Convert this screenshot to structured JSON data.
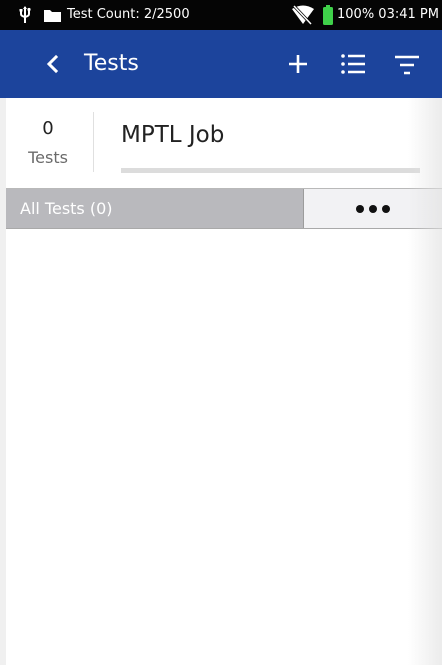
{
  "status_bar": {
    "test_count": "Test Count: 2/2500",
    "battery_time": "100% 03:41 PM"
  },
  "app_bar": {
    "title": "Tests"
  },
  "job": {
    "test_count": "0",
    "test_count_label": "Tests",
    "name": "MPTL Job"
  },
  "tests_section": {
    "label": "All Tests (0)"
  },
  "colors": {
    "app_bar": "#1c449c",
    "status_bar": "#050505",
    "tests_bar": "#b9b9bd",
    "battery": "#3fd14a"
  }
}
